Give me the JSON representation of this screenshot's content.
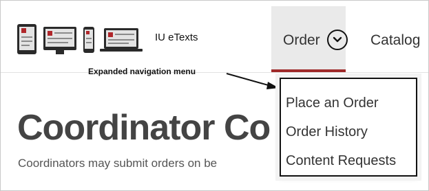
{
  "header": {
    "brand": "IU eTexts",
    "devices_icon_name": "devices-icon",
    "nav": {
      "order_label": "Order",
      "order_chevron_icon": "chevron-down-icon",
      "catalog_label": "Catalog"
    },
    "accent_color": "#9f2a2a"
  },
  "annotation": {
    "text": "Expanded navigation menu"
  },
  "dropdown": {
    "items": [
      {
        "label": "Place an Order"
      },
      {
        "label": "Order History"
      },
      {
        "label": "Content Requests"
      }
    ]
  },
  "main": {
    "title": "Coordinator Co",
    "description": "Coordinators may submit orders on be"
  }
}
